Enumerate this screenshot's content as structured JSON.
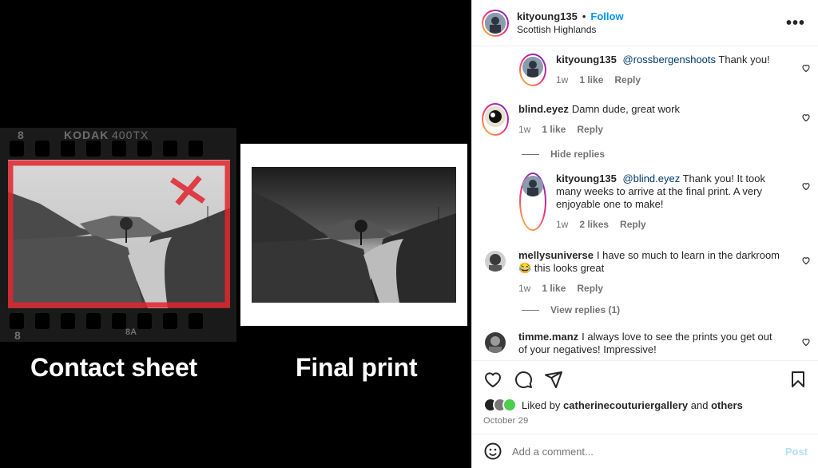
{
  "media": {
    "film_brand": "KODAK",
    "film_type": "400TX",
    "film_frame_top": "8",
    "film_frame_bottom": "8",
    "film_frame_number": "8A",
    "caption_left": "Contact sheet",
    "caption_right": "Final print"
  },
  "header": {
    "username": "kityoung135",
    "separator": "•",
    "follow_label": "Follow",
    "location": "Scottish Highlands",
    "more_label": "•••"
  },
  "comments": [
    {
      "username": "kityoung135",
      "mention": "@rossbergenshoots",
      "text": " Thank you!",
      "time": "1w",
      "likes": "1 like",
      "reply": "Reply"
    },
    {
      "username": "blind.eyez",
      "mention": "",
      "text": "Damn dude, great work",
      "time": "1w",
      "likes": "1 like",
      "reply": "Reply"
    },
    {
      "username": "kityoung135",
      "mention": "@blind.eyez",
      "text": " Thank you! It took many weeks to arrive at the final print. A very enjoyable one to make!",
      "time": "1w",
      "likes": "2 likes",
      "reply": "Reply"
    },
    {
      "username": "mellysuniverse",
      "mention": "",
      "text": "I have so much to learn in the darkroom 😂 this looks great",
      "time": "1w",
      "likes": "1 like",
      "reply": "Reply"
    },
    {
      "username": "timme.manz",
      "mention": "",
      "text": "I always love to see the prints you get out of your negatives! Impressive!",
      "time": "",
      "likes": "",
      "reply": ""
    }
  ],
  "replies": {
    "hide_label": "Hide replies",
    "view_label": "View replies (1)"
  },
  "actions": {
    "liked_by_prefix": "Liked by",
    "liked_by_user": "catherinecouturiergallery",
    "liked_by_and": "and",
    "liked_by_others": "others",
    "date": "October 29"
  },
  "composer": {
    "placeholder": "Add a comment...",
    "post_label": "Post"
  },
  "colors": {
    "link_blue": "#0095f6",
    "mention_blue": "#00376b",
    "muted": "#737373",
    "red_marker": "#e0242d"
  }
}
